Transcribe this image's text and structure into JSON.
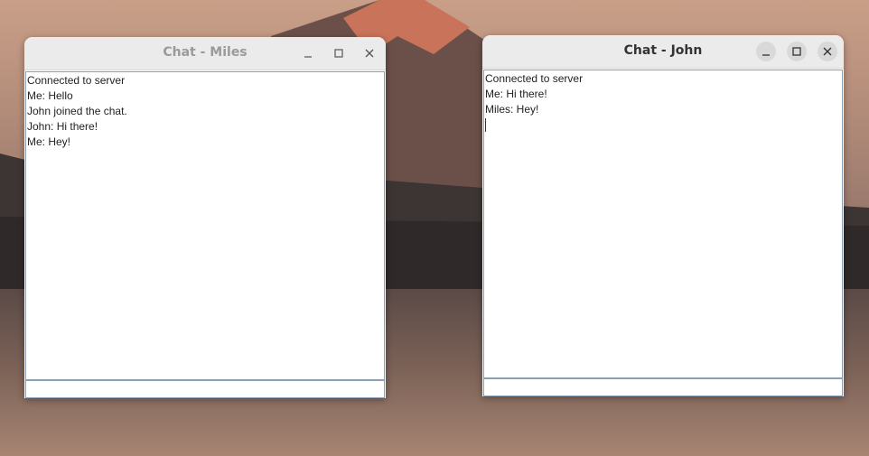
{
  "windows": [
    {
      "title": "Chat - Miles",
      "messages": [
        "Connected to server",
        "Me: Hello",
        "John joined the chat.",
        "John: Hi there!",
        "Me: Hey!"
      ],
      "input_value": ""
    },
    {
      "title": "Chat - John",
      "messages": [
        "Connected to server",
        "Me: Hi there!",
        "Miles: Hey!"
      ],
      "input_value": ""
    }
  ],
  "icons": [
    "minimize-icon",
    "maximize-icon",
    "close-icon"
  ]
}
